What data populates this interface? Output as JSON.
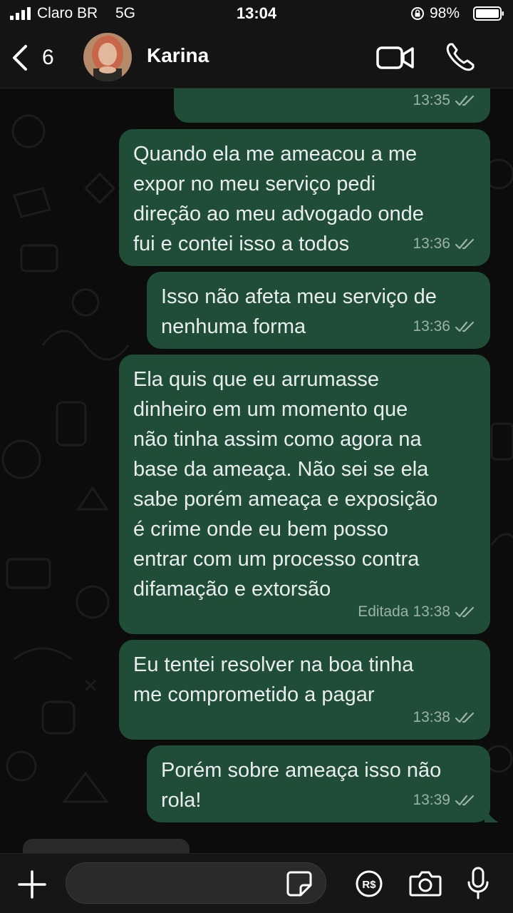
{
  "status_bar": {
    "carrier": "Claro BR",
    "network": "5G",
    "time": "13:04",
    "battery": "98%",
    "icons": [
      "signal-icon",
      "orientation-lock-icon",
      "battery-icon"
    ]
  },
  "header": {
    "back_count": "6",
    "contact_name": "Karina",
    "icons": [
      "chevron-left-icon",
      "video-call-icon",
      "phone-icon"
    ]
  },
  "messages": [
    {
      "text": "",
      "time": "13:35",
      "edited": ""
    },
    {
      "text": "Quando ela me ameacou a me\nexpor no meu serviço pedi\ndireção ao meu advogado onde\nfui e contei isso a todos",
      "time": "13:36",
      "edited": ""
    },
    {
      "text": "Isso não afeta meu serviço de\nnenhuma forma",
      "time": "13:36",
      "edited": ""
    },
    {
      "text": "Ela quis que eu arrumasse\ndinheiro em um momento que\nnão tinha assim como agora na\nbase da ameaça. Não sei se ela\nsabe porém ameaça e exposição\né crime onde eu bem posso\nentrar com um processo contra\ndifamação e extorsão",
      "time": "13:38",
      "edited": "Editada"
    },
    {
      "text": "Eu tentei resolver na boa tinha\nme comprometido a pagar",
      "time": "13:38",
      "edited": ""
    },
    {
      "text": "Porém sobre ameaça isso não\nrola!",
      "time": "13:39",
      "edited": ""
    }
  ],
  "input_bar": {
    "placeholder": "",
    "icons": [
      "plus-icon",
      "sticker-icon",
      "payment-icon",
      "camera-icon",
      "microphone-icon"
    ]
  },
  "colors": {
    "outgoing_bubble": "#1f4d37",
    "background": "#0c0c0c",
    "bar": "#161616"
  }
}
